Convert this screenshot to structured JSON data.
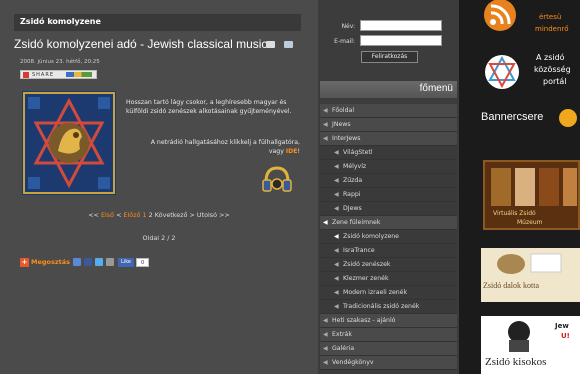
{
  "main": {
    "section_header": "Zsidó komolyzene",
    "title": "Zsidó komolyzenei adó - Jewish classical music",
    "date": "2008. június 23. hétfő, 20:25",
    "share_label": "SHARE",
    "intro": "Hosszan tartó lágy csokor, a leghíresebb magyar és külföldi zsidó zenészek alkotásainak gyűjteményével.",
    "listen_text": "A netrádió hallgatásához klikkelj a fülhallgatóra, vagy",
    "listen_link": "IDE",
    "listen_end": "!",
    "pager": {
      "first": "<<",
      "first_label": "Első",
      "prev_lt": "<",
      "prev_label": "Előző",
      "page1": "1",
      "page2": "2",
      "next": "Következő",
      "next_gt": ">",
      "last": "Utolsó",
      "last_gt": ">>"
    },
    "page_of": "Oldal 2 / 2",
    "social": {
      "megosztas": "Megosztás",
      "like": "Like",
      "count": "0"
    }
  },
  "login": {
    "name_label": "Név:",
    "email_label": "E-mail:",
    "button": "Feliratkozás"
  },
  "menu": {
    "title": "főmenü",
    "items": [
      {
        "label": "Főoldal",
        "lvl": 0
      },
      {
        "label": "JNews",
        "lvl": 0
      },
      {
        "label": "InterJews",
        "lvl": 0
      },
      {
        "label": "VilágStetl",
        "lvl": 1
      },
      {
        "label": "Mélyvíz",
        "lvl": 1
      },
      {
        "label": "Zűzda",
        "lvl": 1
      },
      {
        "label": "Rappi",
        "lvl": 1
      },
      {
        "label": "DJews",
        "lvl": 1
      },
      {
        "label": "Zene füleimnek",
        "lvl": 0
      },
      {
        "label": "Zsidó komolyzene",
        "lvl": 1
      },
      {
        "label": "IsraTrance",
        "lvl": 1
      },
      {
        "label": "Zsidó zenészek",
        "lvl": 1
      },
      {
        "label": "Klezmer zenék",
        "lvl": 1
      },
      {
        "label": "Modern izraeli zenék",
        "lvl": 1
      },
      {
        "label": "Tradicionális zsidó zenék",
        "lvl": 1
      },
      {
        "label": "Heti szakasz - ajánló",
        "lvl": 0
      },
      {
        "label": "Extrák",
        "lvl": 0
      },
      {
        "label": "Galéria",
        "lvl": 0
      },
      {
        "label": "Vendégkönyv",
        "lvl": 0
      }
    ]
  },
  "banners": {
    "rss_line1": "értesü",
    "rss_line2": "mindenrő",
    "portal1": "A zsidó",
    "portal2": "közösség",
    "portal3": "portál",
    "bannercsere": "Bannercsere",
    "museum1": "Virtuális Zsidó",
    "museum2": "Múzeum",
    "dalok": "Zsidó dalok kotta",
    "kisokos": "Zsidó kisokos",
    "jew": "Jew",
    "us": "U!"
  },
  "colors": {
    "accent": "#ff8c1a",
    "sidebar": "#3c3c3c",
    "main": "#4b4b4b"
  }
}
